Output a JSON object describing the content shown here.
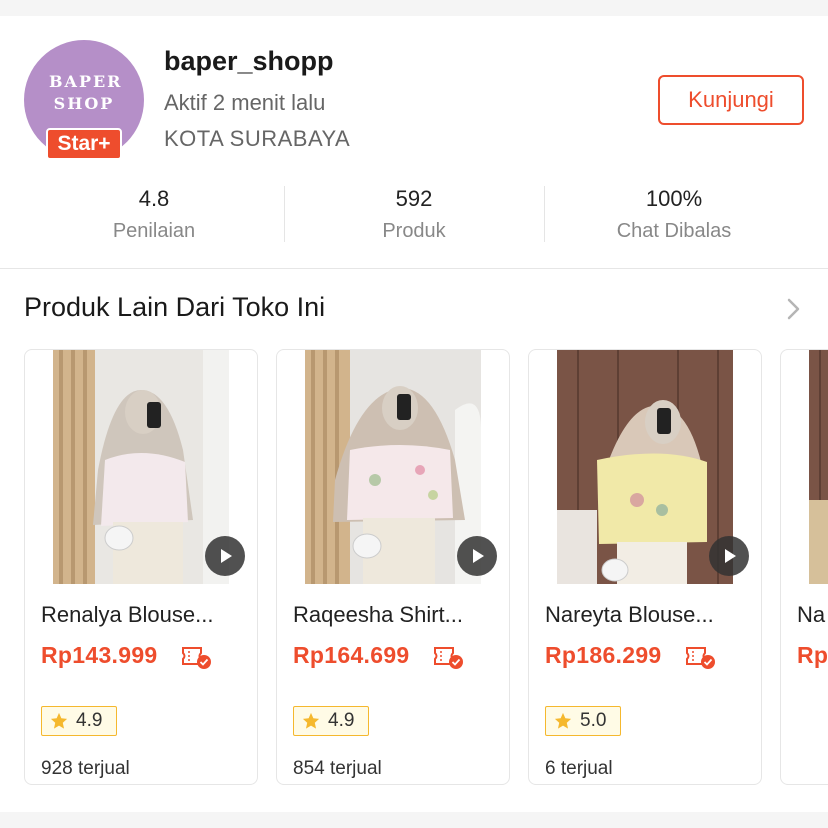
{
  "shop": {
    "avatar_text": "BAPER SHOP",
    "badge": "Star+",
    "name": "baper_shopp",
    "active": "Aktif 2 menit lalu",
    "city": "KOTA SURABAYA",
    "visit_label": "Kunjungi"
  },
  "stats": [
    {
      "value": "4.8",
      "label": "Penilaian"
    },
    {
      "value": "592",
      "label": "Produk"
    },
    {
      "value": "100%",
      "label": "Chat Dibalas"
    }
  ],
  "section": {
    "title": "Produk Lain Dari Toko Ini"
  },
  "products": [
    {
      "name": "Renalya Blouse...",
      "price": "Rp143.999",
      "rating": "4.9",
      "sold": "928 terjual"
    },
    {
      "name": "Raqeesha Shirt...",
      "price": "Rp164.699",
      "rating": "4.9",
      "sold": "854 terjual"
    },
    {
      "name": "Nareyta Blouse...",
      "price": "Rp186.299",
      "rating": "5.0",
      "sold": "6 terjual"
    },
    {
      "name": "Na",
      "price": "Rp"
    }
  ],
  "colors": {
    "accent": "#ee4d2d",
    "star": "#f5b82e",
    "avatar_bg": "#b58fc8"
  },
  "icons": {
    "video": "play-icon",
    "voucher": "voucher-icon",
    "more": "chevron-right-icon",
    "rating": "star-icon"
  }
}
